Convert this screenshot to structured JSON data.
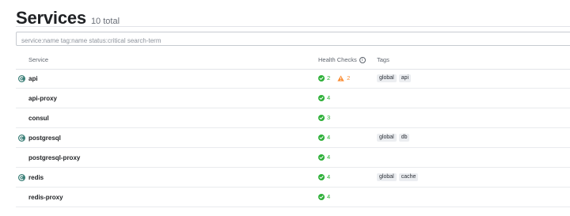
{
  "header": {
    "title": "Services",
    "count": "10 total"
  },
  "search": {
    "placeholder": "service:name tag:name status:critical search-term",
    "value": ""
  },
  "table": {
    "columns": {
      "service": "Service",
      "health": "Health Checks",
      "tags": "Tags"
    },
    "rows": [
      {
        "name": "api",
        "icon": "consul-service-icon",
        "passing": "2",
        "warning": "2",
        "tags": [
          "global",
          "api"
        ]
      },
      {
        "name": "api-proxy",
        "icon": "",
        "passing": "4",
        "warning": "",
        "tags": []
      },
      {
        "name": "consul",
        "icon": "",
        "passing": "3",
        "warning": "",
        "tags": []
      },
      {
        "name": "postgresql",
        "icon": "consul-service-icon",
        "passing": "4",
        "warning": "",
        "tags": [
          "global",
          "db"
        ]
      },
      {
        "name": "postgresql-proxy",
        "icon": "",
        "passing": "4",
        "warning": "",
        "tags": []
      },
      {
        "name": "redis",
        "icon": "consul-service-icon",
        "passing": "4",
        "warning": "",
        "tags": [
          "global",
          "cache"
        ]
      },
      {
        "name": "redis-proxy",
        "icon": "",
        "passing": "4",
        "warning": "",
        "tags": []
      }
    ]
  },
  "colors": {
    "passing": "#2eb039",
    "warning": "#fa8f37",
    "service_icon": "#3b7f77"
  }
}
